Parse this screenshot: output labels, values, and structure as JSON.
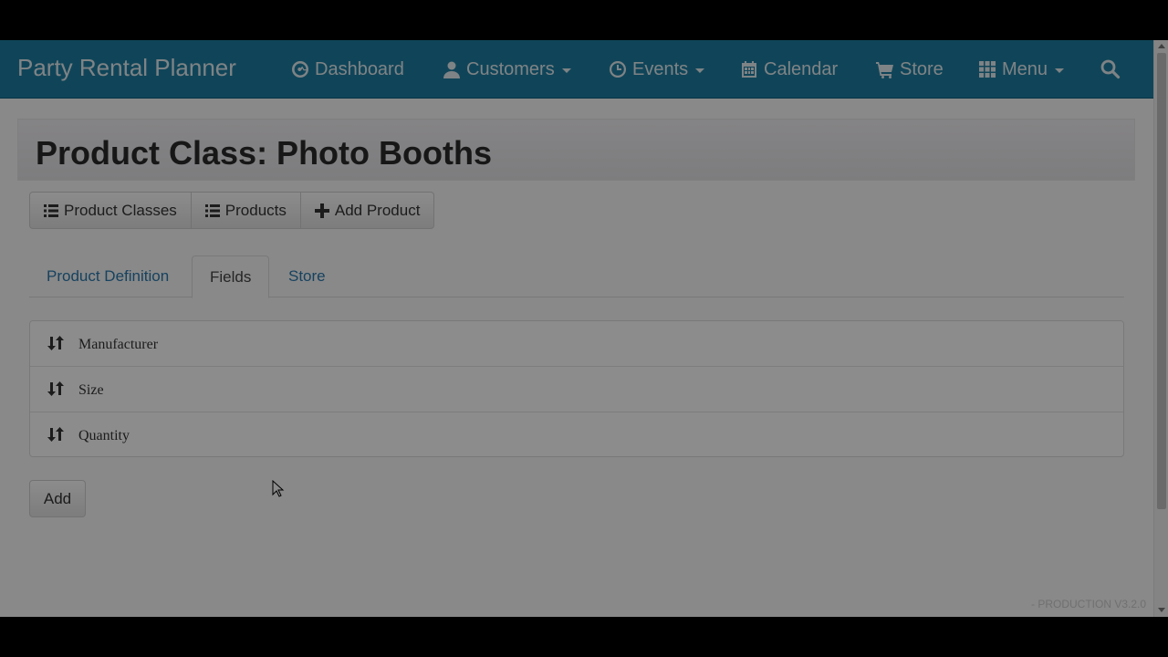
{
  "navbar": {
    "brand": "Party Rental Planner",
    "items": [
      {
        "label": "Dashboard",
        "icon": "dashboard-icon"
      },
      {
        "label": "Customers",
        "icon": "user-icon",
        "dropdown": true
      },
      {
        "label": "Events",
        "icon": "clock-icon",
        "dropdown": true
      },
      {
        "label": "Calendar",
        "icon": "calendar-icon"
      },
      {
        "label": "Store",
        "icon": "cart-icon"
      },
      {
        "label": "Menu",
        "icon": "grid-icon",
        "dropdown": true
      }
    ],
    "search_icon": "search-icon"
  },
  "page": {
    "title": "Product Class: Photo Booths"
  },
  "toolbar": {
    "product_classes_label": "Product Classes",
    "products_label": "Products",
    "add_product_label": "Add Product"
  },
  "tabs": {
    "product_definition": "Product Definition",
    "fields": "Fields",
    "store": "Store",
    "active": "Fields"
  },
  "fields": [
    "Manufacturer",
    "Size",
    "Quantity"
  ],
  "add_button_label": "Add",
  "footer": {
    "version": "- PRODUCTION V3.2.0"
  },
  "colors": {
    "navbar": "#1e7fa3",
    "link": "#2a78ad"
  }
}
